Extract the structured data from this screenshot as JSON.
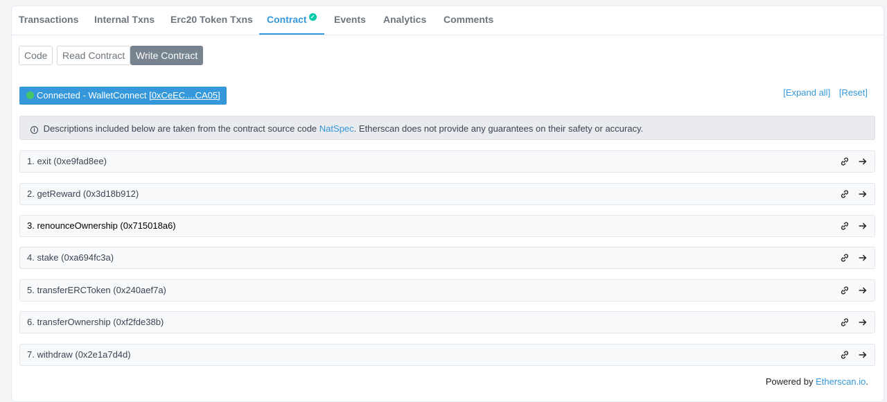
{
  "tabs": [
    {
      "label": "Transactions"
    },
    {
      "label": "Internal Txns"
    },
    {
      "label": "Erc20 Token Txns"
    },
    {
      "label": "Contract",
      "verified_mark": "✓"
    },
    {
      "label": "Events"
    },
    {
      "label": "Analytics"
    },
    {
      "label": "Comments"
    }
  ],
  "subtabs": [
    {
      "label": "Code"
    },
    {
      "label": "Read Contract"
    },
    {
      "label": "Write Contract"
    }
  ],
  "wallet": {
    "status_text": "Connected - WalletConnect",
    "address": "[0xCeEC....CA05]"
  },
  "links": {
    "expand_all": "[Expand all]",
    "reset": "[Reset]"
  },
  "notice": {
    "before": "Descriptions included below are taken from the contract source code",
    "link": "NatSpec",
    "after": ". Etherscan does not provide any guarantees on their safety or accuracy."
  },
  "functions": [
    {
      "label": "1. exit (0xe9fad8ee)"
    },
    {
      "label": "2. getReward (0x3d18b912)"
    },
    {
      "label": "3. renounceOwnership (0x715018a6)"
    },
    {
      "label": "4. stake (0xa694fc3a)"
    },
    {
      "label": "5. transferERCToken (0x240aef7a)"
    },
    {
      "label": "6. transferOwnership (0xf2fde38b)"
    },
    {
      "label": "7. withdraw (0x2e1a7d4d)"
    }
  ],
  "footer": {
    "powered_by": "Powered by",
    "link": "Etherscan.io",
    "suffix": "."
  },
  "colors": {
    "accent": "#3498db",
    "connected_dot": "#45c767",
    "verified": "#00c9a7"
  }
}
